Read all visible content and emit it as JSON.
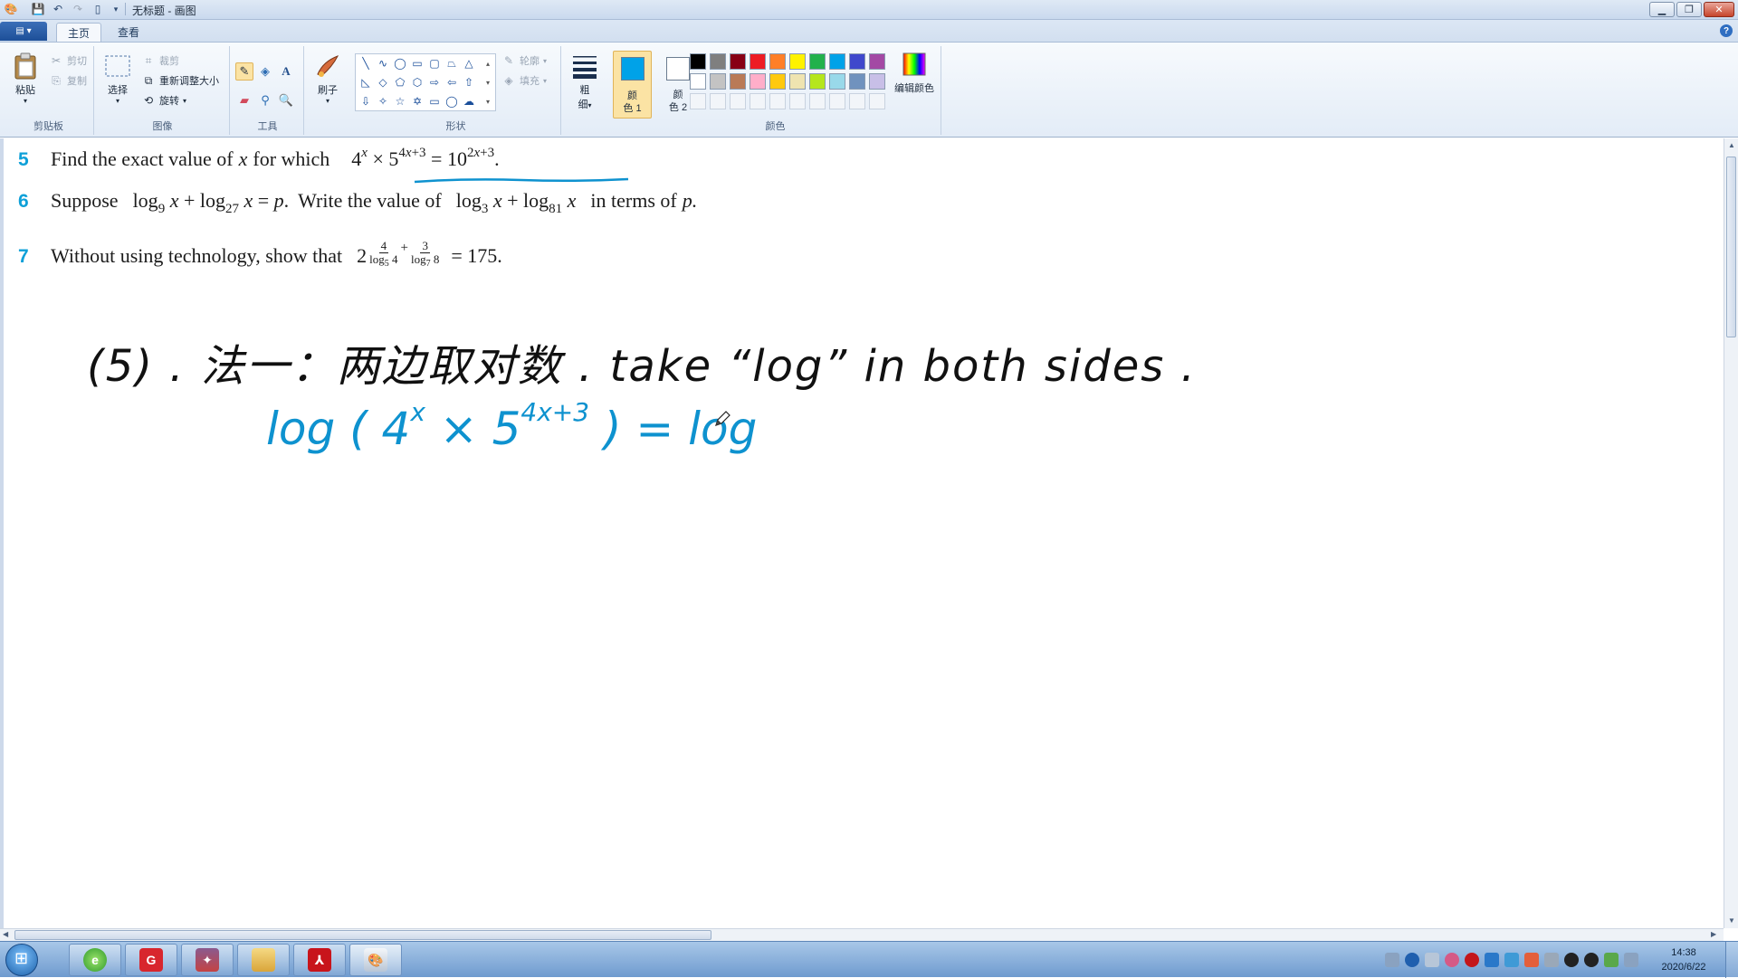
{
  "window": {
    "title": "无标题 - 画图"
  },
  "ribbon": {
    "tabs": [
      {
        "label": "主页"
      },
      {
        "label": "查看"
      }
    ],
    "clipboard": {
      "group_label": "剪贴板",
      "paste": "粘贴",
      "cut": "剪切",
      "copy": "复制"
    },
    "image": {
      "group_label": "图像",
      "select": "选择",
      "crop": "裁剪",
      "resize": "重新调整大小",
      "rotate": "旋转"
    },
    "tools": {
      "group_label": "工具"
    },
    "brushes": {
      "label": "刷子"
    },
    "shapes": {
      "group_label": "形状",
      "outline": "轮廓",
      "fill": "填充"
    },
    "size": {
      "label_1": "粗",
      "label_2": "细"
    },
    "colors": {
      "group_label": "颜色",
      "color1_l1": "颜",
      "color1_l2": "色 1",
      "color2_l1": "颜",
      "color2_l2": "色 2",
      "edit_colors": "编辑颜色",
      "color1_value": "#00a2e8",
      "color2_value": "#ffffff",
      "palette_row1": [
        "#000000",
        "#7f7f7f",
        "#880015",
        "#ed1c24",
        "#ff7f27",
        "#fff200",
        "#22b14c",
        "#00a2e8",
        "#3f48cc",
        "#a349a4"
      ],
      "palette_row2": [
        "#ffffff",
        "#c3c3c3",
        "#b97a57",
        "#ffaec9",
        "#ffc90e",
        "#efe4b0",
        "#b5e61d",
        "#99d9ea",
        "#7092be",
        "#c8bfe7"
      ]
    }
  },
  "canvas": {
    "questions": [
      {
        "num": "5",
        "text": "Find the exact value of",
        "var": "x",
        "text2": "for which"
      },
      {
        "num": "6",
        "text": "Suppose",
        "text2": "Write the value of",
        "text3": "in terms of",
        "var": "p."
      },
      {
        "num": "7",
        "text": "Without using technology, show that",
        "result": "= 175."
      }
    ],
    "handwriting": {
      "line1": "(5) . 法一：两边取对数 .  take “log” in both sides  .",
      "line2": "log ( 4",
      "line2_sup1": "x",
      "line2_mid": " × 5",
      "line2_sup2": "4x+3",
      "line2_end": " ) = log"
    }
  },
  "taskbar": {
    "clock_time": "14:38",
    "clock_date": "2020/6/22"
  }
}
